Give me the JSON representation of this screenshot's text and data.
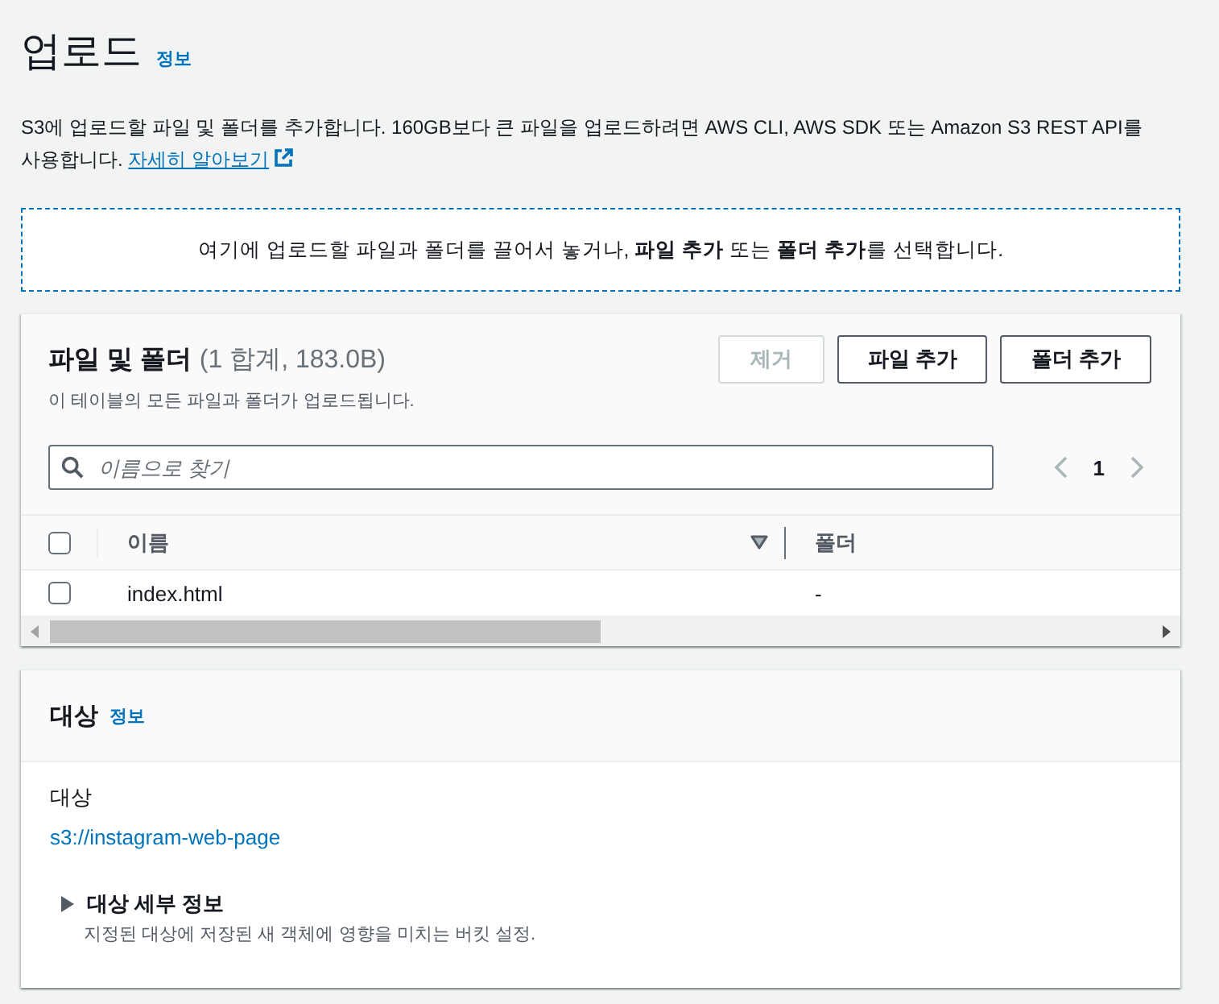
{
  "page": {
    "title": "업로드",
    "info_link": "정보",
    "description": "S3에 업로드할 파일 및 폴더를 추가합니다. 160GB보다 큰 파일을 업로드하려면 AWS CLI, AWS SDK 또는 Amazon S3 REST API를 사용합니다.",
    "learn_more_link": "자세히 알아보기"
  },
  "dropzone": {
    "text": "여기에 업로드할 파일과 폴더를 끌어서 놓거나, **파일 추가** 또는 **폴더 추가**를 선택합니다."
  },
  "files_panel": {
    "title": "파일 및 폴더",
    "count": "(1 합계, 183.0B)",
    "subtitle": "이 테이블의 모든 파일과 폴더가 업로드됩니다.",
    "buttons": [
      {
        "label": "제거",
        "disabled": true
      },
      {
        "label": "파일 추가",
        "disabled": false
      },
      {
        "label": "폴더 추가",
        "disabled": false
      }
    ],
    "search": {
      "placeholder": "이름으로 찾기"
    },
    "pagination": {
      "current_page": "1",
      "prev_disabled": true,
      "next_disabled": true
    },
    "table": {
      "select_all_checked": false,
      "columns": [
        {
          "label": "이름",
          "sortable": true
        },
        {
          "label": "폴더",
          "sortable": false
        }
      ],
      "rows": [
        {
          "checked": false,
          "cells": [
            "index.html",
            "-"
          ]
        }
      ]
    }
  },
  "destination_panel": {
    "title": "대상",
    "info_link": "정보",
    "label": "대상",
    "value": "s3://instagram-web-page",
    "details": {
      "title": "대상 세부 정보",
      "description": "지정된 대상에 저장된 새 객체에 영향을 미치는 버킷 설정.",
      "expanded": false
    }
  }
}
